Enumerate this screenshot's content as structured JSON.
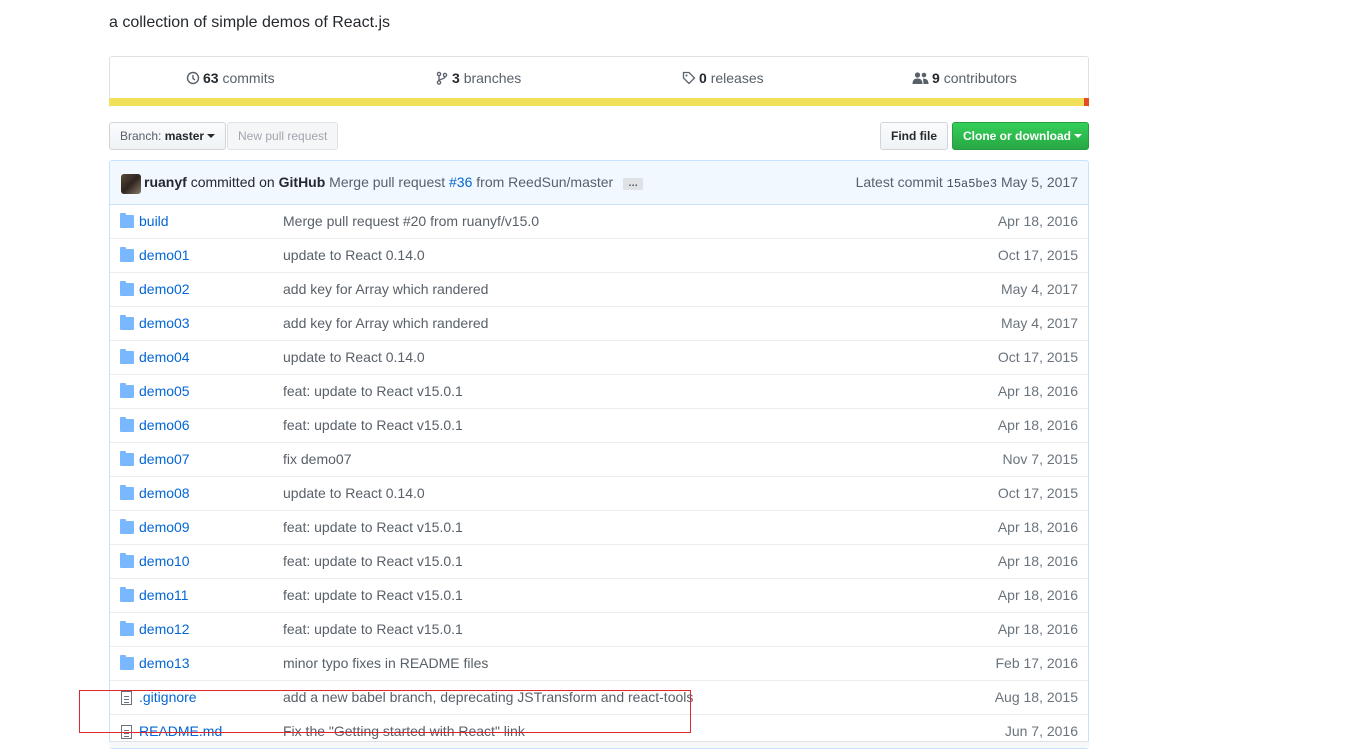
{
  "repo": {
    "description": "a collection of simple demos of React.js"
  },
  "summary": {
    "commits": {
      "count": "63",
      "label": "commits",
      "icon": "history-icon"
    },
    "branches": {
      "count": "3",
      "label": "branches",
      "icon": "branch-icon"
    },
    "releases": {
      "count": "0",
      "label": "releases",
      "icon": "tag-icon"
    },
    "contributors": {
      "count": "9",
      "label": "contributors",
      "icon": "people-icon"
    },
    "language_colors": [
      "#f1e05a",
      "#e34c26"
    ]
  },
  "toolbar": {
    "branch_prefix": "Branch:",
    "branch_name": "master",
    "new_pull_request": "New pull request",
    "find_file": "Find file",
    "clone_or_download": "Clone or download"
  },
  "latest_commit": {
    "author": "ruanyf",
    "committed_on": "committed on",
    "committer": "GitHub",
    "message_prefix": "Merge pull request",
    "pr_link": "#36",
    "message_suffix": "from ReedSun/master",
    "ellipsis": "…",
    "latest_label": "Latest commit",
    "sha": "15a5be3",
    "date": "May 5, 2017"
  },
  "files": [
    {
      "type": "folder",
      "name": "build",
      "message": "Merge pull request #20 from ruanyf/v15.0",
      "age": "Apr 18, 2016"
    },
    {
      "type": "folder",
      "name": "demo01",
      "message": "update to React 0.14.0",
      "age": "Oct 17, 2015"
    },
    {
      "type": "folder",
      "name": "demo02",
      "message": "add key for Array which randered",
      "age": "May 4, 2017"
    },
    {
      "type": "folder",
      "name": "demo03",
      "message": "add key for Array which randered",
      "age": "May 4, 2017"
    },
    {
      "type": "folder",
      "name": "demo04",
      "message": "update to React 0.14.0",
      "age": "Oct 17, 2015"
    },
    {
      "type": "folder",
      "name": "demo05",
      "message": "feat: update to React v15.0.1",
      "age": "Apr 18, 2016"
    },
    {
      "type": "folder",
      "name": "demo06",
      "message": "feat: update to React v15.0.1",
      "age": "Apr 18, 2016"
    },
    {
      "type": "folder",
      "name": "demo07",
      "message": "fix demo07",
      "age": "Nov 7, 2015"
    },
    {
      "type": "folder",
      "name": "demo08",
      "message": "update to React 0.14.0",
      "age": "Oct 17, 2015"
    },
    {
      "type": "folder",
      "name": "demo09",
      "message": "feat: update to React v15.0.1",
      "age": "Apr 18, 2016"
    },
    {
      "type": "folder",
      "name": "demo10",
      "message": "feat: update to React v15.0.1",
      "age": "Apr 18, 2016"
    },
    {
      "type": "folder",
      "name": "demo11",
      "message": "feat: update to React v15.0.1",
      "age": "Apr 18, 2016"
    },
    {
      "type": "folder",
      "name": "demo12",
      "message": "feat: update to React v15.0.1",
      "age": "Apr 18, 2016"
    },
    {
      "type": "folder",
      "name": "demo13",
      "message": "minor typo fixes in README files",
      "age": "Feb 17, 2016"
    },
    {
      "type": "file",
      "name": ".gitignore",
      "message": "add a new babel branch, deprecating JSTransform and react-tools",
      "age": "Aug 18, 2015"
    },
    {
      "type": "file",
      "name": "README.md",
      "message": "Fix the \"Getting started with React\" link",
      "age": "Jun 7, 2016"
    }
  ]
}
